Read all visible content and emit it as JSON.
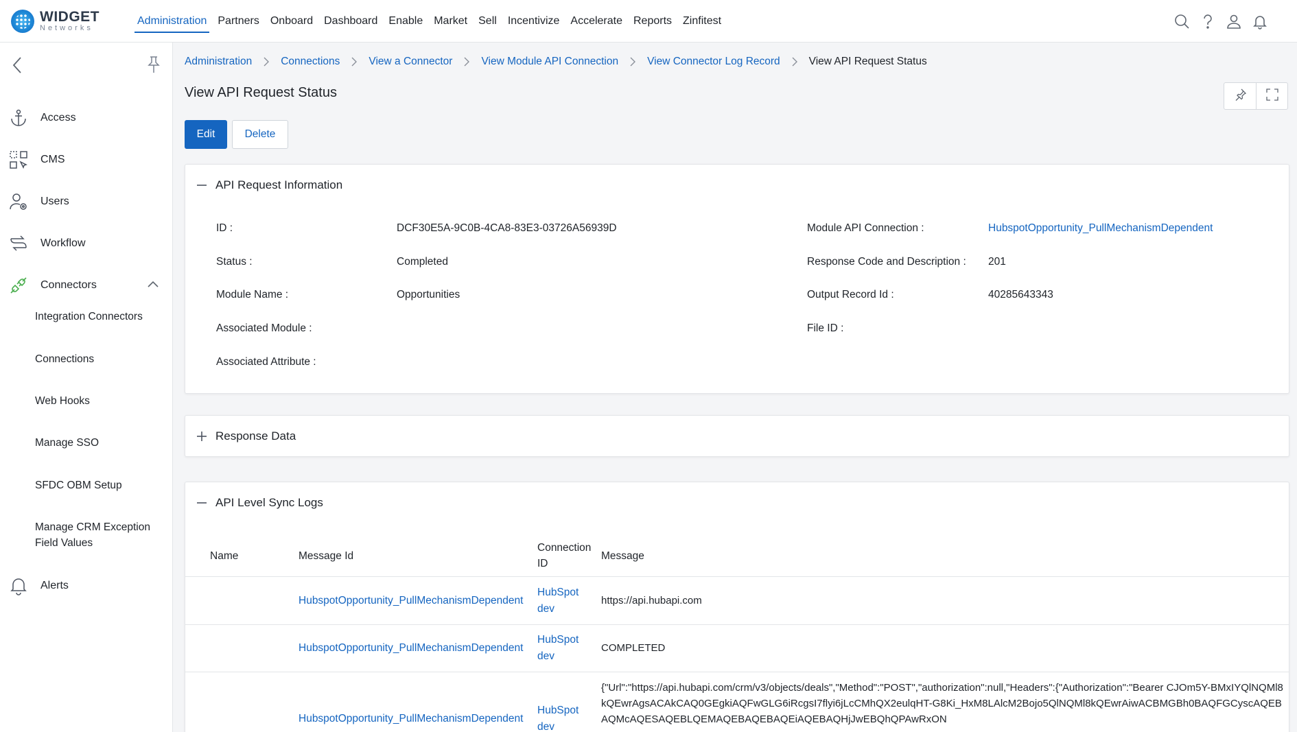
{
  "brand": {
    "name": "WIDGET",
    "tagline": "Networks"
  },
  "topnav": {
    "items": [
      {
        "label": "Administration"
      },
      {
        "label": "Partners"
      },
      {
        "label": "Onboard"
      },
      {
        "label": "Dashboard"
      },
      {
        "label": "Enable"
      },
      {
        "label": "Market"
      },
      {
        "label": "Sell"
      },
      {
        "label": "Incentivize"
      },
      {
        "label": "Accelerate"
      },
      {
        "label": "Reports"
      },
      {
        "label": "Zinfitest"
      }
    ],
    "active_index": 0,
    "icons": [
      "search-icon",
      "help-icon",
      "user-icon",
      "bell-icon"
    ]
  },
  "sidebar": {
    "items": [
      {
        "label": "Access",
        "icon": "anchor-icon"
      },
      {
        "label": "CMS",
        "icon": "cms-icon"
      },
      {
        "label": "Users",
        "icon": "users-icon"
      },
      {
        "label": "Workflow",
        "icon": "workflow-icon"
      },
      {
        "label": "Connectors",
        "icon": "connectors-icon"
      },
      {
        "label": "Alerts",
        "icon": "bell-icon"
      }
    ],
    "sub_items": [
      {
        "label": "Integration Connectors"
      },
      {
        "label": "Connections"
      },
      {
        "label": "Web Hooks"
      },
      {
        "label": "Manage SSO"
      },
      {
        "label": "SFDC OBM Setup"
      },
      {
        "label": "Manage CRM Exception Field Values"
      }
    ],
    "accent": "#4caf50"
  },
  "breadcrumb": [
    {
      "label": "Administration"
    },
    {
      "label": "Connections"
    },
    {
      "label": "View a Connector"
    },
    {
      "label": "View Module API Connection"
    },
    {
      "label": "View Connector Log Record"
    },
    {
      "label": "View API Request Status"
    }
  ],
  "page": {
    "title": "View API Request Status",
    "edit_label": "Edit",
    "delete_label": "Delete"
  },
  "api_info": {
    "title": "API Request Information",
    "left": [
      {
        "label": "ID :",
        "value": "DCF30E5A-9C0B-4CA8-83E3-03726A56939D"
      },
      {
        "label": "Status :",
        "value": "Completed"
      },
      {
        "label": "Module Name :",
        "value": "Opportunities"
      },
      {
        "label": "Associated Module :",
        "value": ""
      },
      {
        "label": "Associated Attribute :",
        "value": ""
      }
    ],
    "right": [
      {
        "label": "Module API Connection :",
        "value": "HubspotOpportunity_PullMechanismDependent"
      },
      {
        "label": "Response Code and Description :",
        "value": "201"
      },
      {
        "label": "Output Record Id :",
        "value": "40285643343"
      },
      {
        "label": "File ID :",
        "value": ""
      }
    ]
  },
  "response_data": {
    "title": "Response Data"
  },
  "sync_logs": {
    "title": "API Level Sync Logs",
    "headers": {
      "name": "Name",
      "message_id": "Message Id",
      "connection_id": "Connection ID",
      "message": "Message"
    },
    "rows": [
      {
        "name": "",
        "message_id": "HubspotOpportunity_PullMechanismDependent",
        "connection_id": "HubSpot dev",
        "message": "https://api.hubapi.com"
      },
      {
        "name": "",
        "message_id": "HubspotOpportunity_PullMechanismDependent",
        "connection_id": "HubSpot dev",
        "message": "COMPLETED"
      },
      {
        "name": "",
        "message_id": "HubspotOpportunity_PullMechanismDependent",
        "connection_id": "HubSpot dev",
        "message": "{\"Url\":\"https://api.hubapi.com/crm/v3/objects/deals\",\"Method\":\"POST\",\"authorization\":null,\"Headers\":{\"Authorization\":\"Bearer CJOm5Y-BMxIYQlNQMl8kQEwrAgsACAkCAQ0GEgkiAQFwGLG6iRcgsI7flyi6jLcCMhQX2eulqHT-G8Ki_HxM8LAlcM2Bojo5QlNQMl8kQEwrAiwACBMGBh0BAQFGCyscAQEBAQMcAQESAQEBLQEMAQEBAQEBAQEiAQEBAQHjJwEBQhQPAwRxON"
      }
    ]
  },
  "colors": {
    "primary": "#1565c0",
    "sidebar_active_icon": "#4caf50"
  }
}
